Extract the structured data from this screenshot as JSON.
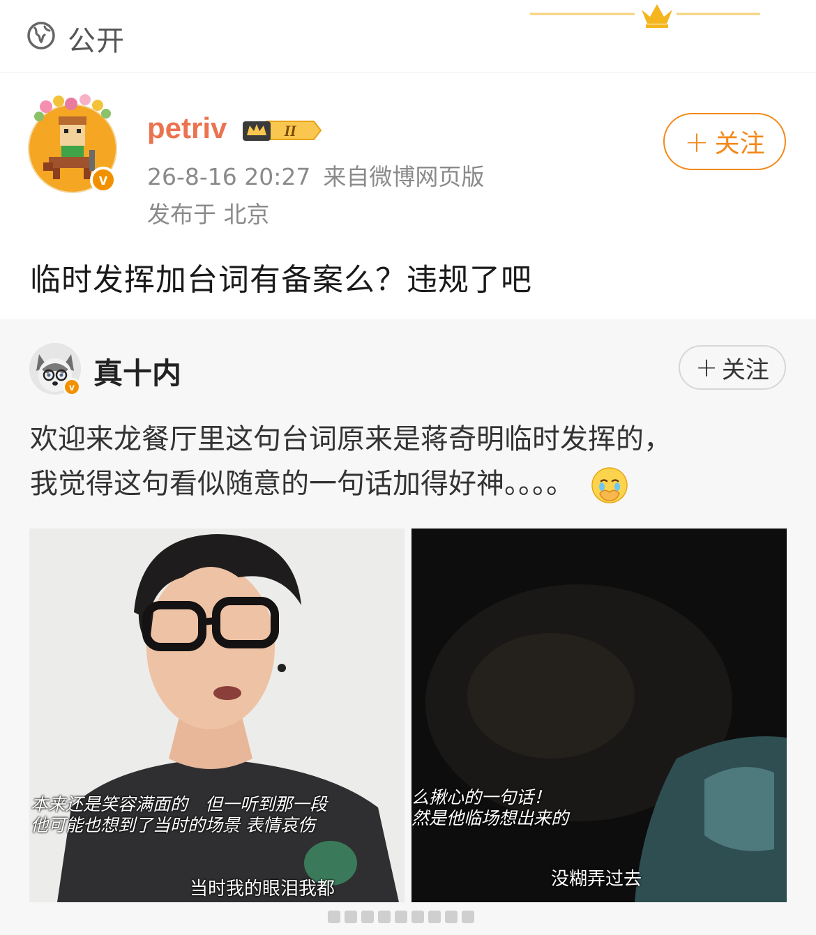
{
  "visibility": {
    "label": "公开",
    "icon": "globe-icon"
  },
  "post": {
    "username": "petriv",
    "badge_level": "II",
    "timestamp": "26-8-16 20:27",
    "source": "来自微博网页版",
    "location": "发布于 北京",
    "follow_label": "关注",
    "text": "临时发挥加台词有备案么？违规了吧"
  },
  "retweet": {
    "username": "真十内",
    "follow_label": "关注",
    "text_line1": "欢迎来龙餐厅里这句台词原来是蒋奇明临时发挥的，",
    "text_line2": "我觉得这句看似随意的一句话加得好神。。。。",
    "emoji": "crying-face-emoji",
    "images": [
      {
        "subtitle_1": "本来还是笑容满面的　但一听到那一段",
        "subtitle_2": "他可能也想到了当时的场景 表情哀伤",
        "caption": "当时我的眼泪我都"
      },
      {
        "subtitle_1": "么揪心的一句话！",
        "subtitle_2": "然是他临场想出来的",
        "caption": "没糊弄过去"
      }
    ]
  },
  "colors": {
    "accent": "#f3891a",
    "username": "#eb7350",
    "verified": "#f29100"
  }
}
